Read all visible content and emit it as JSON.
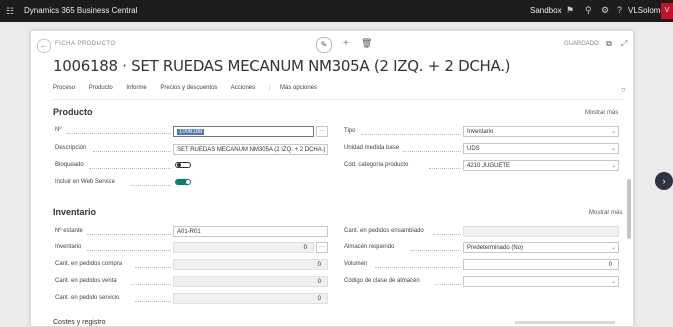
{
  "topbar": {
    "app_title": "Dynamics 365 Business Central",
    "environment": "Sandbox",
    "user": "VLSolomor",
    "avatar": "V"
  },
  "page": {
    "caption": "FICHA PRODUCTO",
    "saved_status": "GUARDADO",
    "title": "1006188 · SET RUEDAS MECANUM NM305A (2 IZQ. + 2 DCHA.)",
    "actions": [
      "Proceso",
      "Producto",
      "Informe",
      "Precios y descuentos",
      "Acciones"
    ],
    "more_options": "Más opciones"
  },
  "producto": {
    "heading": "Producto",
    "show_more": "Mostrar más",
    "fields_left": [
      {
        "label": "Nº",
        "value": "1006188"
      },
      {
        "label": "Descripción",
        "value": "SET RUEDAS MECANUM NM305A (2 IZQ. + 2 DCHA.)"
      },
      {
        "label": "Bloqueado",
        "value": ""
      },
      {
        "label": "Incluir en Web Service",
        "value": ""
      }
    ],
    "fields_right": [
      {
        "label": "Tipo",
        "value": "Inventario"
      },
      {
        "label": "Unidad medida base",
        "value": "UDS"
      },
      {
        "label": "Cód. categoría producto",
        "value": "4210 JUGUETE"
      }
    ]
  },
  "inventario": {
    "heading": "Inventario",
    "show_more": "Mostrar más",
    "fields_left": [
      {
        "label": "Nº estante",
        "value": "A01-R01"
      },
      {
        "label": "Inventario",
        "value": "0"
      },
      {
        "label": "Cant. en pedidos compra",
        "value": "0"
      },
      {
        "label": "Cant. en pedidos venta",
        "value": "0"
      },
      {
        "label": "Cant. en pedido servicio",
        "value": "0"
      }
    ],
    "fields_right": [
      {
        "label": "Cant. en pedidos ensamblado",
        "value": ""
      },
      {
        "label": "Almacén requerido",
        "value": "Predeterminado (No)"
      },
      {
        "label": "Volumen",
        "value": "0"
      },
      {
        "label": "Código de clase de almacén",
        "value": ""
      }
    ]
  },
  "footer": {
    "next_section": "Costes y registro"
  }
}
